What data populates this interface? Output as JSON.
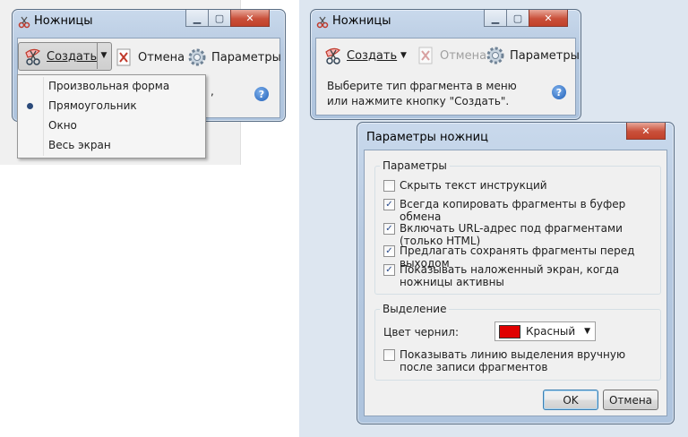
{
  "left_window": {
    "title": "Ножницы",
    "toolbar": {
      "create_label": "Создать",
      "cancel_label": "Отмена",
      "options_label": "Параметры"
    },
    "menu": {
      "items": [
        {
          "label": "Произвольная форма",
          "selected": false
        },
        {
          "label": "Прямоугольник",
          "selected": true
        },
        {
          "label": "Окно",
          "selected": false
        },
        {
          "label": "Весь экран",
          "selected": false
        }
      ]
    },
    "partial_text": ","
  },
  "right_window": {
    "title": "Ножницы",
    "toolbar": {
      "create_label": "Создать",
      "cancel_label": "Отмена",
      "options_label": "Параметры"
    },
    "instruction": "Выберите тип фрагмента в меню или нажмите кнопку \"Создать\"."
  },
  "dialog": {
    "title": "Параметры ножниц",
    "group_params": {
      "title": "Параметры",
      "options": [
        {
          "label": "Скрыть текст инструкций",
          "checked": false
        },
        {
          "label": "Всегда копировать фрагменты в буфер обмена",
          "checked": true
        },
        {
          "label": "Включать URL-адрес под фрагментами (только HTML)",
          "checked": true
        },
        {
          "label": "Предлагать сохранять фрагменты перед выходом",
          "checked": true
        },
        {
          "label": "Показывать наложенный экран, когда ножницы активны",
          "checked": true
        }
      ]
    },
    "group_selection": {
      "title": "Выделение",
      "ink_label": "Цвет чернил:",
      "ink_value": "Красный",
      "ink_color": "#e00000",
      "show_line_label": "Показывать линию выделения вручную после записи фрагментов",
      "show_line_checked": false
    },
    "ok_label": "OK",
    "cancel_label": "Отмена"
  },
  "colors": {
    "check": "#2a4b8d",
    "frame": "#b6c9e0",
    "close_button": "#c9503a"
  }
}
